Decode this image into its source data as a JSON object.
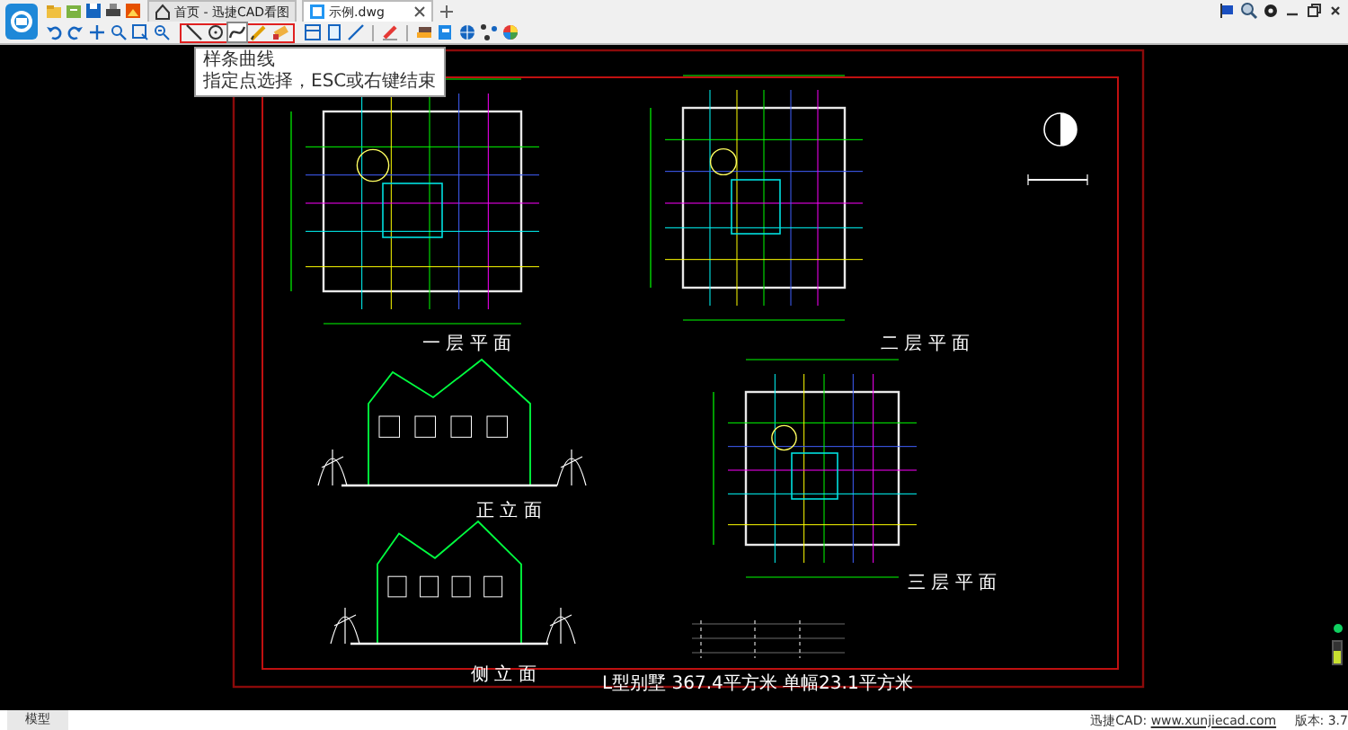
{
  "tabs": [
    {
      "label": "首页 - 迅捷CAD看图",
      "kind": "home",
      "selected": false
    },
    {
      "label": "示例.dwg",
      "kind": "file",
      "selected": true
    }
  ],
  "drawing_tools": [
    {
      "selected": false
    },
    {
      "selected": false
    },
    {
      "selected": true
    },
    {
      "selected": false
    },
    {
      "selected": false
    }
  ],
  "tooltip": {
    "title": "样条曲线",
    "hint": "指定点选择，ESC或右键结束"
  },
  "drawing": {
    "captions": [
      "一 层 平 面",
      "二 层 平 面",
      "正 立 面",
      "三 层 平 面",
      "侧 立 面"
    ],
    "title_block": "L型别墅   367.4平方米   单幅23.1平方米"
  },
  "status_bar": {
    "tab": "模型",
    "prefix": "迅捷CAD: ",
    "link": "www.xunjiecad.com",
    "version": " 版本: 3.7"
  }
}
